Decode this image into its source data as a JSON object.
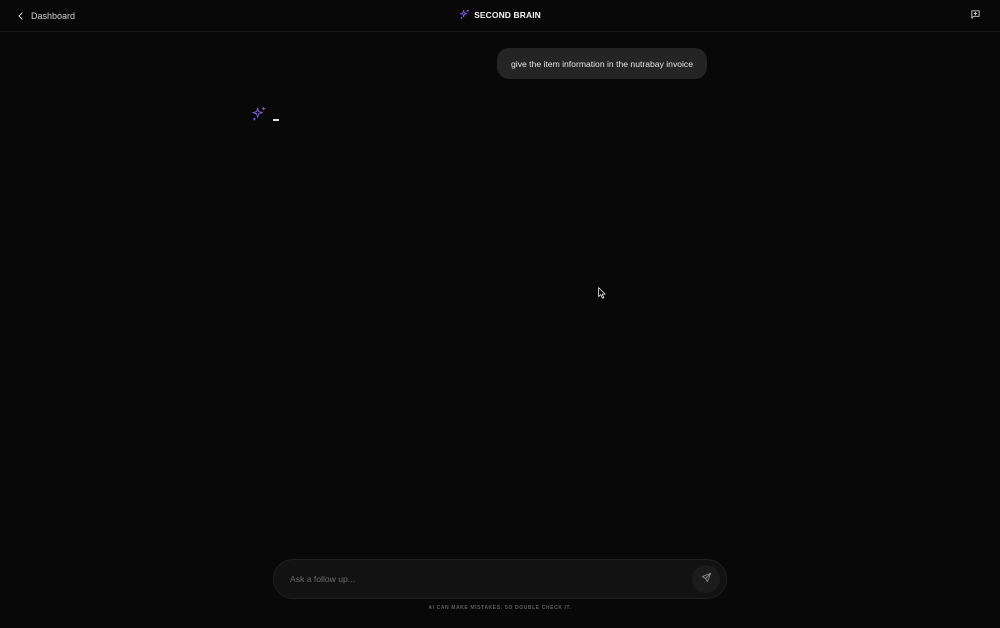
{
  "header": {
    "back_label": "Dashboard",
    "brand_name": "SECOND BRAIN",
    "back_icon": "chevron-left-icon",
    "brand_icon": "sparkles-icon",
    "new_chat_icon": "message-square-plus-icon"
  },
  "conversation": {
    "messages": [
      {
        "role": "user",
        "text": "give the item information in the nutrabay invoice"
      },
      {
        "role": "assistant",
        "text": "",
        "state": "typing",
        "icon": "sparkles-icon"
      }
    ]
  },
  "composer": {
    "placeholder": "Ask a follow up...",
    "value": "",
    "send_icon": "send-icon"
  },
  "footer": {
    "disclaimer": "AI CAN MAKE MISTAKES. SO DOUBLE CHECK IT."
  },
  "colors": {
    "background": "#080808",
    "accent": "#8b5cf6",
    "bubble": "#242424"
  }
}
